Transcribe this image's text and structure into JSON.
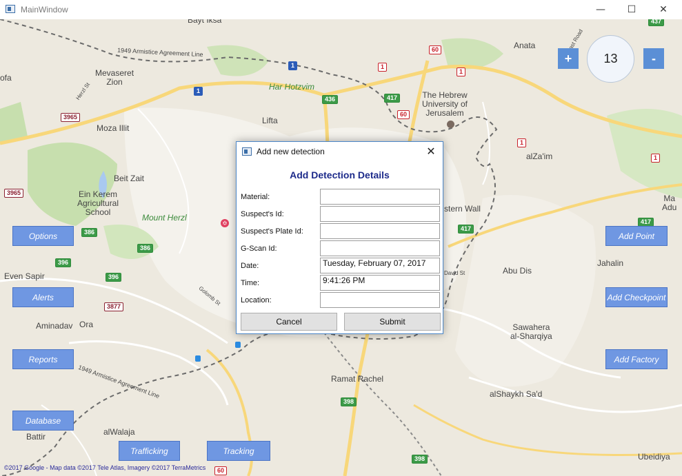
{
  "window": {
    "title": "MainWindow",
    "minimize_glyph": "—",
    "maximize_glyph": "☐",
    "close_glyph": "✕"
  },
  "map": {
    "places": [
      {
        "name": "place-bayt-iksa",
        "text": "Bayt Iksa"
      },
      {
        "name": "place-anata",
        "text": "Anata"
      },
      {
        "name": "place-mevaseret-zion",
        "text": "Mevaseret\nZion"
      },
      {
        "name": "place-har-hotzvim",
        "text": "Har Hotzvim"
      },
      {
        "name": "place-hebrew-university",
        "text": "The Hebrew\nUniversity of\nJerusalem"
      },
      {
        "name": "place-lifta",
        "text": "Lifta"
      },
      {
        "name": "place-moza-illit",
        "text": "Moza Illit"
      },
      {
        "name": "place-alzaim",
        "text": "alZa'im"
      },
      {
        "name": "place-beit-zait",
        "text": "Beit Zait"
      },
      {
        "name": "place-ein-kerem",
        "text": "Ein Kerem\nAgricultural\nSchool"
      },
      {
        "name": "place-mount-herzl",
        "text": "Mount Herzl"
      },
      {
        "name": "place-western-wall",
        "text": "stern Wall"
      },
      {
        "name": "place-jahalin",
        "text": "Jahalin"
      },
      {
        "name": "place-even-sapir",
        "text": "Even Sapir"
      },
      {
        "name": "place-abu-dis",
        "text": "Abu Dis"
      },
      {
        "name": "place-aminadav",
        "text": "Aminadav"
      },
      {
        "name": "place-ora",
        "text": "Ora"
      },
      {
        "name": "place-sawahera",
        "text": "Sawahera\nal-Sharqiya"
      },
      {
        "name": "place-ramat-rachel",
        "text": "Ramat Rachel"
      },
      {
        "name": "place-alshaykh-sad",
        "text": "alShaykh Sa'd"
      },
      {
        "name": "place-battir",
        "text": "Battir"
      },
      {
        "name": "place-alwalaja",
        "text": "alWalaja"
      },
      {
        "name": "place-ubeidiya",
        "text": "Ubeidiya"
      },
      {
        "name": "place-ofa",
        "text": "ofa"
      },
      {
        "name": "place-ma",
        "text": "Ma\nAdu"
      }
    ],
    "shields": [
      {
        "name": "route-437-shield",
        "text": "437",
        "style": "green"
      },
      {
        "name": "route-60-shield",
        "text": "60",
        "style": "red"
      },
      {
        "name": "route-1-shield",
        "text": "1",
        "style": "blue"
      },
      {
        "name": "route-1-shield",
        "text": "1",
        "style": "red"
      },
      {
        "name": "route-1-shield",
        "text": "1",
        "style": "blue"
      },
      {
        "name": "route-436-shield",
        "text": "436",
        "style": "green"
      },
      {
        "name": "route-417-shield",
        "text": "417",
        "style": "green"
      },
      {
        "name": "route-60-shield",
        "text": "60",
        "style": "red"
      },
      {
        "name": "route-3965-shield",
        "text": "3965",
        "style": "maroon"
      },
      {
        "name": "route-1-shield",
        "text": "1",
        "style": "red"
      },
      {
        "name": "route-1-shield",
        "text": "1",
        "style": "red"
      },
      {
        "name": "route-3965-shield",
        "text": "3965",
        "style": "maroon"
      },
      {
        "name": "route-386-shield",
        "text": "386",
        "style": "green"
      },
      {
        "name": "route-386-shield",
        "text": "386",
        "style": "green"
      },
      {
        "name": "route-417-shield",
        "text": "417",
        "style": "green"
      },
      {
        "name": "route-417-shield",
        "text": "417",
        "style": "green"
      },
      {
        "name": "route-396-shield",
        "text": "396",
        "style": "green"
      },
      {
        "name": "route-396-shield",
        "text": "396",
        "style": "green"
      },
      {
        "name": "route-3877-shield",
        "text": "3877",
        "style": "maroon"
      },
      {
        "name": "route-398-shield",
        "text": "398",
        "style": "green"
      },
      {
        "name": "route-398-shield",
        "text": "398",
        "style": "green"
      },
      {
        "name": "route-60-shield",
        "text": "60",
        "style": "red"
      },
      {
        "name": "route-1-shield",
        "text": "1",
        "style": "red"
      },
      {
        "name": "route-60-shield",
        "text": "60",
        "style": "red"
      }
    ],
    "roads": [
      {
        "name": "road-label-armistice-north",
        "text": "1949 Armistice Agreement Line"
      },
      {
        "name": "road-label-armistice-south",
        "text": "1949 Armistice Agreement Line"
      },
      {
        "name": "road-label-herzl",
        "text": "Herzl St"
      },
      {
        "name": "road-label-golomb",
        "text": "Golomb St"
      },
      {
        "name": "road-label-david",
        "text": "David St"
      },
      {
        "name": "road-label-east",
        "text": "East Road"
      }
    ],
    "copyright": "©2017 Google - Map data ©2017 Tele Atlas, Imagery ©2017 TerraMetrics"
  },
  "zoom": {
    "plus_label": "+",
    "level": "13",
    "minus_label": "-"
  },
  "left_buttons": {
    "options": "Options",
    "alerts": "Alerts",
    "reports": "Reports",
    "database": "Database"
  },
  "bottom_buttons": {
    "trafficking": "Trafficking",
    "tracking": "Tracking"
  },
  "right_buttons": {
    "add_point": "Add Point",
    "add_checkpoint": "Add Checkpoint",
    "add_factory": "Add Factory"
  },
  "dialog": {
    "title": "Add new detection",
    "close_glyph": "✕",
    "heading": "Add Detection Details",
    "fields": [
      {
        "label": "Material:",
        "value": ""
      },
      {
        "label": "Suspect's Id:",
        "value": ""
      },
      {
        "label": "Suspect's Plate Id:",
        "value": ""
      },
      {
        "label": "G-Scan Id:",
        "value": ""
      },
      {
        "label": "Date:",
        "value": "Tuesday, February 07, 2017"
      },
      {
        "label": "Time:",
        "value": "9:41:26 PM"
      },
      {
        "label": "Location:",
        "value": ""
      }
    ],
    "cancel_label": "Cancel",
    "submit_label": "Submit"
  }
}
